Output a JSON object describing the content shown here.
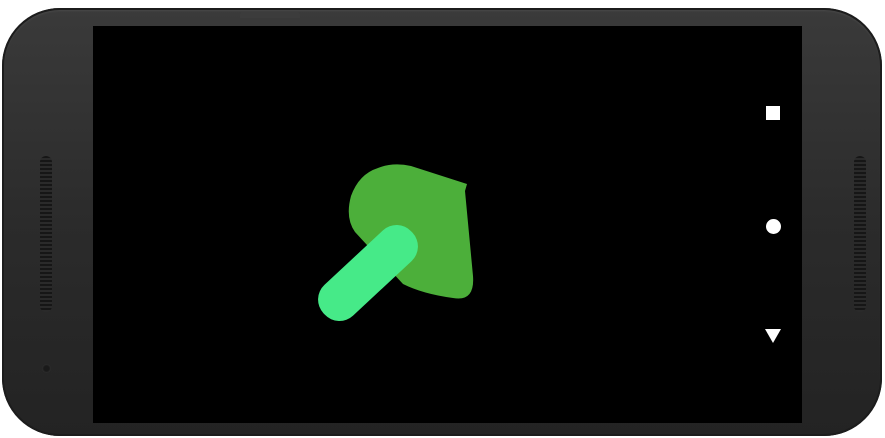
{
  "app": {
    "screen_background": "#000000",
    "device_frame_color": "#2f2f2f"
  },
  "game": {
    "arrow_head_color": "#4caf3a",
    "arrow_shaft_color": "#46ea88"
  },
  "nav_bar": {
    "buttons": [
      {
        "name": "recents",
        "icon": "square-icon"
      },
      {
        "name": "home",
        "icon": "circle-icon"
      },
      {
        "name": "back",
        "icon": "triangle-down-icon"
      }
    ]
  }
}
